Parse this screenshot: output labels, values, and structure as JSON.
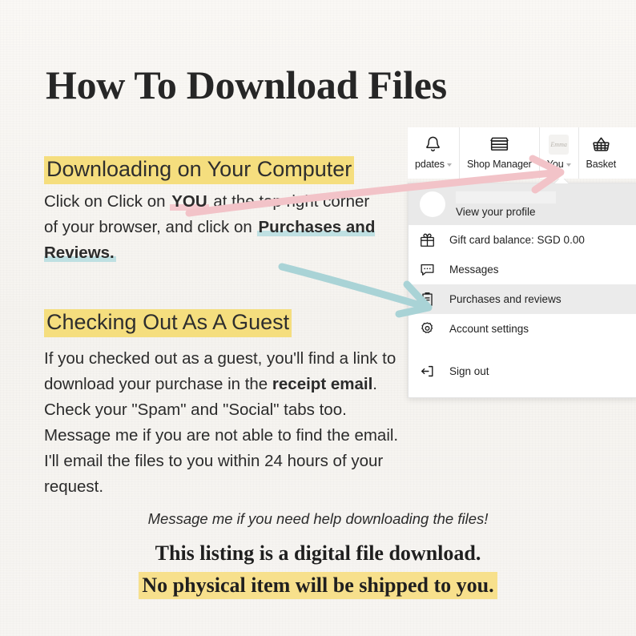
{
  "page": {
    "title": "How To Download Files",
    "background_color": "#f7f5f1",
    "text_color": "#2b2b2b"
  },
  "colors": {
    "highlight_yellow": "#f5de7e",
    "highlight_pink": "#f4c9ce",
    "highlight_teal": "#bfe0e2",
    "arrow_pink": "#f2c3c8",
    "arrow_teal": "#a9d3d6",
    "footer_yellow": "#f7e08c"
  },
  "sections": {
    "computer": {
      "heading": "Downloading on Your Computer",
      "body_pre": "Click on Click on ",
      "body_you": "YOU",
      "body_mid": " at the top right corner of your browser, and click on ",
      "body_link": "Purchases and Reviews."
    },
    "guest": {
      "heading": "Checking Out As A Guest",
      "body_pre": "If you checked out as a guest, you'll find a link to download your purchase in the ",
      "body_bold": "receipt email",
      "body_post": ". Check your \"Spam\" and \"Social\" tabs too. Message me if you are not able to find the email. I'll email the files to you within 24 hours of your request."
    }
  },
  "footer": {
    "italic_note": "Message me if you need help downloading the files!",
    "line1": "This listing is a digital file download.",
    "line2": "No physical item will be shipped to you."
  },
  "etsy": {
    "nav": [
      {
        "label": "pdates",
        "icon": "bell-icon",
        "has_caret": true
      },
      {
        "label": "Shop Manager",
        "icon": "storefront-icon",
        "has_caret": false
      },
      {
        "label": "You",
        "icon": "avatar-icon",
        "has_caret": true
      },
      {
        "label": "Basket",
        "icon": "basket-icon",
        "has_caret": false
      }
    ],
    "dropdown": {
      "profile_label": "View your profile",
      "items": [
        {
          "label": "Gift card balance: SGD 0.00",
          "icon": "gift-icon",
          "active": false
        },
        {
          "label": "Messages",
          "icon": "message-icon",
          "active": false
        },
        {
          "label": "Purchases and reviews",
          "icon": "clipboard-icon",
          "active": true
        },
        {
          "label": "Account settings",
          "icon": "gear-icon",
          "active": false
        }
      ],
      "sign_out": {
        "label": "Sign out",
        "icon": "sign-out-icon"
      }
    }
  }
}
